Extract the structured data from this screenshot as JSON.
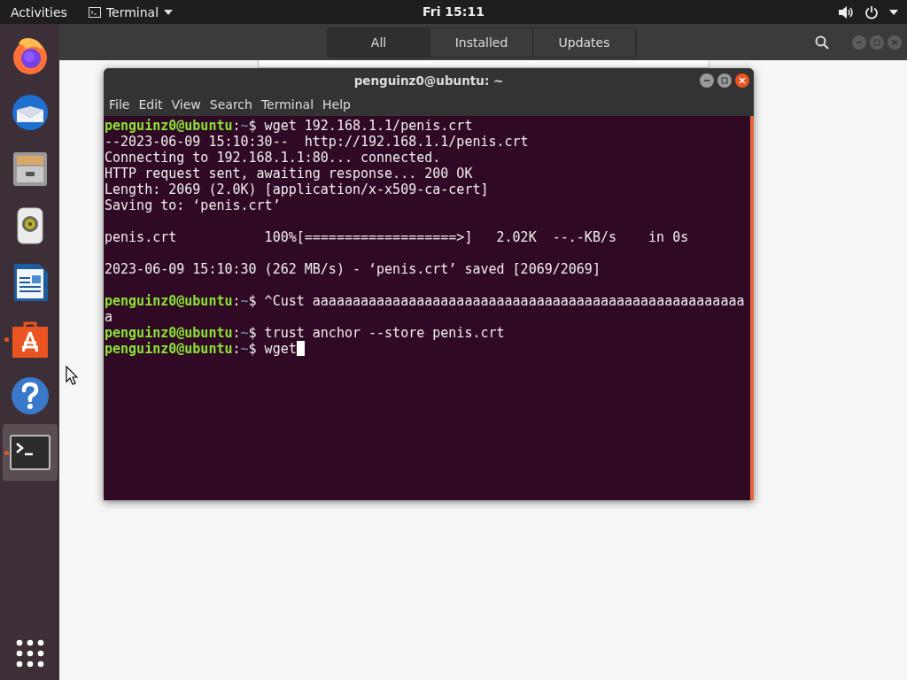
{
  "top_bar": {
    "activities": "Activities",
    "app_menu": "Terminal",
    "clock": "Fri 15:11"
  },
  "dock": {
    "items": [
      {
        "kind": "browser",
        "running": false,
        "selected": false
      },
      {
        "kind": "mail",
        "running": false,
        "selected": false
      },
      {
        "kind": "files",
        "running": false,
        "selected": false
      },
      {
        "kind": "music",
        "running": false,
        "selected": false
      },
      {
        "kind": "writer",
        "running": false,
        "selected": false
      },
      {
        "kind": "software",
        "running": true,
        "selected": false
      },
      {
        "kind": "help",
        "running": false,
        "selected": false
      },
      {
        "kind": "terminal",
        "running": true,
        "selected": true
      }
    ]
  },
  "software_window": {
    "tabs": [
      {
        "label": "All",
        "selected": true
      },
      {
        "label": "Installed",
        "selected": false
      },
      {
        "label": "Updates",
        "selected": false
      }
    ]
  },
  "terminal": {
    "title": "penguinz0@ubuntu: ~",
    "menu": [
      "File",
      "Edit",
      "View",
      "Search",
      "Terminal",
      "Help"
    ],
    "lines": [
      {
        "kind": "prompt",
        "prompt": {
          "user": "penguinz0@ubuntu",
          "separator": ":",
          "cwd": "~",
          "symbol": "$"
        },
        "command": "wget 192.168.1.1/penis.crt"
      },
      {
        "kind": "output",
        "text": "--2023-06-09 15:10:30--  http://192.168.1.1/penis.crt"
      },
      {
        "kind": "output",
        "text": "Connecting to 192.168.1.1:80... connected."
      },
      {
        "kind": "output",
        "text": "HTTP request sent, awaiting response... 200 OK"
      },
      {
        "kind": "output",
        "text": "Length: 2069 (2.0K) [application/x-x509-ca-cert]"
      },
      {
        "kind": "output",
        "text": "Saving to: ‘penis.crt’"
      },
      {
        "kind": "blank"
      },
      {
        "kind": "output",
        "text": "penis.crt           100%[===================>]   2.02K  --.-KB/s    in 0s"
      },
      {
        "kind": "blank"
      },
      {
        "kind": "output",
        "text": "2023-06-09 15:10:30 (262 MB/s) - ‘penis.crt’ saved [2069/2069]"
      },
      {
        "kind": "blank"
      },
      {
        "kind": "prompt",
        "prompt": {
          "user": "penguinz0@ubuntu",
          "separator": ":",
          "cwd": "~",
          "symbol": "$"
        },
        "command": "^Cust aaaaaaaaaaaaaaaaaaaaaaaaaaaaaaaaaaaaaaaaaaaaaaaaaaaaaaa"
      },
      {
        "kind": "prompt",
        "prompt": {
          "user": "penguinz0@ubuntu",
          "separator": ":",
          "cwd": "~",
          "symbol": "$"
        },
        "command": "trust anchor --store penis.crt"
      },
      {
        "kind": "prompt",
        "prompt": {
          "user": "penguinz0@ubuntu",
          "separator": ":",
          "cwd": "~",
          "symbol": "$"
        },
        "command": "wget",
        "cursor": true
      }
    ]
  }
}
